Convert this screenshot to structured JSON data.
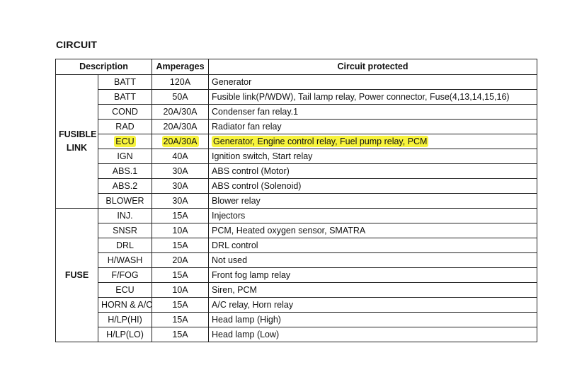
{
  "heading": "CIRCUIT",
  "columns": {
    "description": "Description",
    "amperages": "Amperages",
    "circuit_protected": "Circuit protected"
  },
  "groups": [
    {
      "label_line1": "FUSIBLE",
      "label_line2": "LINK",
      "rows": [
        {
          "name": "BATT",
          "amp": "120A",
          "circuit": "Generator",
          "highlighted": false
        },
        {
          "name": "BATT",
          "amp": "50A",
          "circuit": "Fusible link(P/WDW), Tail lamp relay, Power connector, Fuse(4,13,14,15,16)",
          "highlighted": false
        },
        {
          "name": "COND",
          "amp": "20A/30A",
          "circuit": "Condenser fan relay.1",
          "highlighted": false
        },
        {
          "name": "RAD",
          "amp": "20A/30A",
          "circuit": "Radiator fan relay",
          "highlighted": false
        },
        {
          "name": "ECU",
          "amp": "20A/30A",
          "circuit": "Generator, Engine control relay, Fuel pump relay, PCM",
          "highlighted": true
        },
        {
          "name": "IGN",
          "amp": "40A",
          "circuit": "Ignition switch, Start relay",
          "highlighted": false
        },
        {
          "name": "ABS.1",
          "amp": "30A",
          "circuit": "ABS control (Motor)",
          "highlighted": false
        },
        {
          "name": "ABS.2",
          "amp": "30A",
          "circuit": "ABS control (Solenoid)",
          "highlighted": false
        },
        {
          "name": "BLOWER",
          "amp": "30A",
          "circuit": "Blower relay",
          "highlighted": false
        }
      ]
    },
    {
      "label_line1": "FUSE",
      "label_line2": "",
      "rows": [
        {
          "name": "INJ.",
          "amp": "15A",
          "circuit": "Injectors",
          "highlighted": false
        },
        {
          "name": "SNSR",
          "amp": "10A",
          "circuit": "PCM, Heated oxygen sensor, SMATRA",
          "highlighted": false
        },
        {
          "name": "DRL",
          "amp": "15A",
          "circuit": "DRL control",
          "highlighted": false
        },
        {
          "name": "H/WASH",
          "amp": "20A",
          "circuit": "Not used",
          "highlighted": false
        },
        {
          "name": "F/FOG",
          "amp": "15A",
          "circuit": "Front fog lamp relay",
          "highlighted": false
        },
        {
          "name": "ECU",
          "amp": "10A",
          "circuit": "Siren, PCM",
          "highlighted": false
        },
        {
          "name": "HORN & A/C",
          "amp": "15A",
          "circuit": "A/C relay, Horn relay",
          "highlighted": false
        },
        {
          "name": "H/LP(HI)",
          "amp": "15A",
          "circuit": "Head lamp (High)",
          "highlighted": false
        },
        {
          "name": "H/LP(LO)",
          "amp": "15A",
          "circuit": "Head lamp (Low)",
          "highlighted": false
        }
      ]
    }
  ],
  "highlight_color": "#f7f33c"
}
